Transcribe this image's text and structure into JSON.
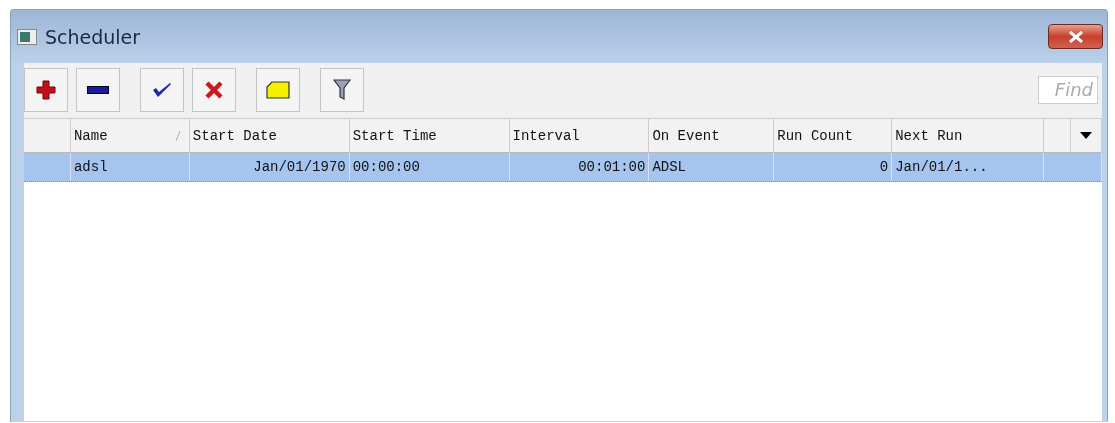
{
  "window": {
    "title": "Scheduler"
  },
  "toolbar": {
    "buttons": [
      {
        "kind": "add"
      },
      {
        "kind": "remove"
      },
      {
        "kind": "enable"
      },
      {
        "kind": "disable"
      },
      {
        "kind": "comment"
      },
      {
        "kind": "filter"
      }
    ],
    "search": {
      "placeholder": "Find"
    }
  },
  "table": {
    "columns": [
      {
        "label": "Name",
        "sorted": true
      },
      {
        "label": "Start Date",
        "sorted": false
      },
      {
        "label": "Start Time",
        "sorted": false
      },
      {
        "label": "Interval",
        "sorted": false
      },
      {
        "label": "On Event",
        "sorted": false
      },
      {
        "label": "Run Count",
        "sorted": false
      },
      {
        "label": "Next Run",
        "sorted": false
      }
    ],
    "rows": [
      {
        "selected": true,
        "cells": [
          "adsl",
          "Jan/01/1970",
          "00:00:00",
          "00:01:00",
          "ADSL",
          "0",
          "Jan/01/1..."
        ]
      }
    ]
  }
}
